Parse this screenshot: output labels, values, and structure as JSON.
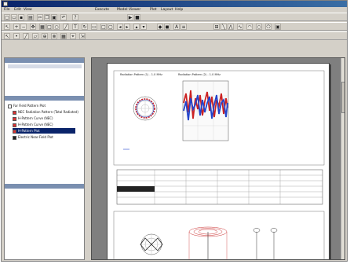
{
  "colors": {
    "accent": "#0a246a",
    "pattern_red": "#cc2222",
    "pattern_blue": "#2244cc"
  },
  "menu": [
    {
      "label": "File"
    },
    {
      "label": "Edit"
    },
    {
      "label": "View"
    },
    {
      "label": "Execute"
    },
    {
      "label": "Model Viewer"
    },
    {
      "label": "Plot"
    },
    {
      "label": "Layout"
    },
    {
      "label": "Help"
    }
  ],
  "toolbar": {
    "row1": [
      "new-icon",
      "open-icon",
      "save-icon",
      "print-icon",
      "cut-icon",
      "copy-icon",
      "paste-icon",
      "undo-icon",
      "help-icon",
      "run-icon",
      "stop-icon"
    ],
    "row2": [
      "arrow-icon",
      "zoom-in-icon",
      "zoom-out-icon",
      "pan-icon",
      "grid-icon",
      "rect-icon",
      "ellipse-icon",
      "line-icon",
      "text-icon",
      "rotate-icon",
      "fit-icon",
      "box-icon",
      "frame-icon",
      "arrow-left-icon",
      "arrow-right-icon",
      "up-icon",
      "down-icon",
      "color-icon",
      "fill-icon",
      "font-icon",
      "align-icon"
    ],
    "row3": [
      "select-icon",
      "node-icon",
      "wire-icon",
      "plate-icon",
      "source-icon",
      "load-icon",
      "mesh-icon"
    ]
  },
  "left": {
    "items": [
      {
        "label": "Far Field Pattern Plot"
      },
      {
        "label": "NEC Radiation Pattern (Total Radiated)"
      },
      {
        "label": "H-Pattern Curve (NEC)"
      },
      {
        "label": "H-Pattern Curve (NEC)"
      },
      {
        "label": "H-Pattern Plot"
      },
      {
        "label": "Electric Near-Field Plot"
      }
    ]
  },
  "page": {
    "plot1_title": "Radiation Pattern (1) - 1.0 MHz",
    "plot2_title": "Radiation Pattern (2) - 1.0 MHz"
  }
}
